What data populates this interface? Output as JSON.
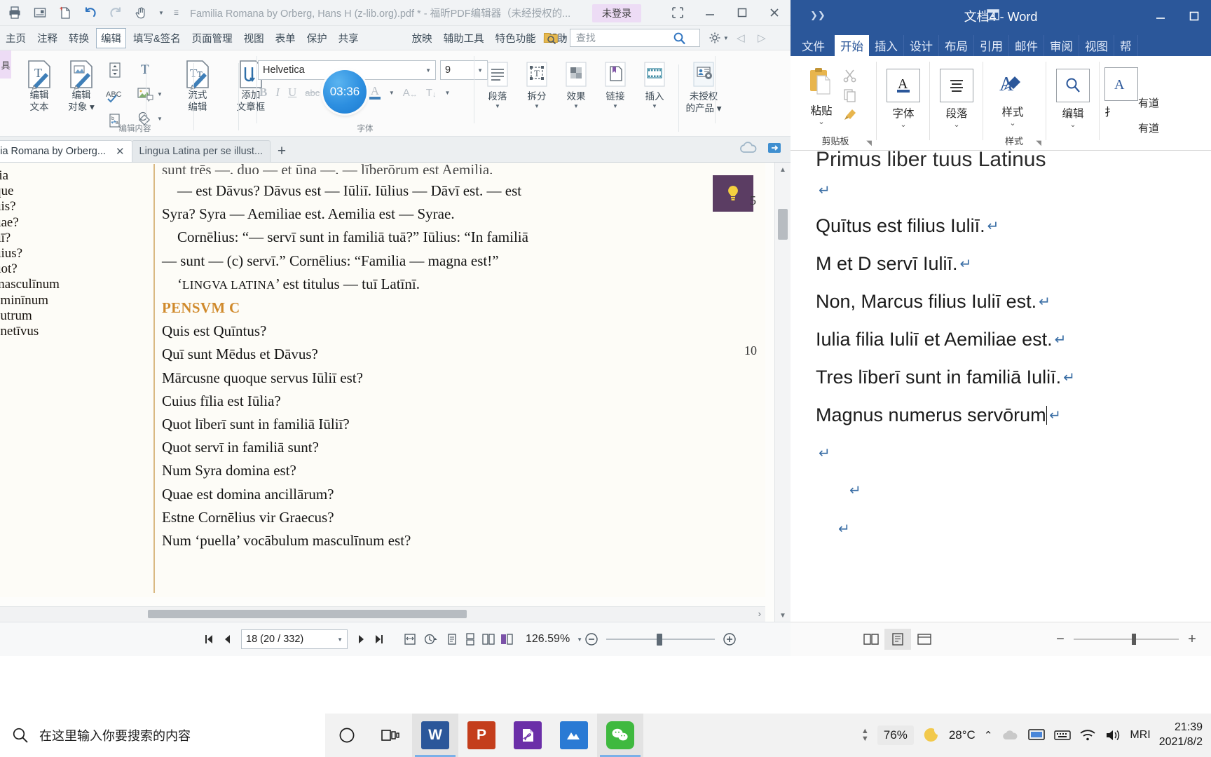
{
  "foxit": {
    "window_title": "Familia Romana by Orberg, Hans H (z-lib.org).pdf * - 福昕PDF编辑器（未经授权的...",
    "login_badge": "未登录",
    "quick_access": [
      "print-icon",
      "new-from-page-icon",
      "new-document-icon",
      "undo-icon",
      "redo-icon",
      "hand-tool-icon",
      "customize-qat-icon"
    ],
    "window_buttons": [
      "restore-layout-icon",
      "minimize-icon",
      "maximize-icon",
      "close-icon"
    ],
    "menus": [
      {
        "label": "主页",
        "active": false
      },
      {
        "label": "注释",
        "active": false
      },
      {
        "label": "转换",
        "active": false
      },
      {
        "label": "编辑",
        "active": true
      },
      {
        "label": "填写&签名",
        "active": false
      },
      {
        "label": "页面管理",
        "active": false
      },
      {
        "label": "视图",
        "active": false
      },
      {
        "label": "表单",
        "active": false
      },
      {
        "label": "保护",
        "active": false
      },
      {
        "label": "共享",
        "active": false
      },
      {
        "label": "放映",
        "active": false
      },
      {
        "label": "辅助工具",
        "active": false
      },
      {
        "label": "特色功能",
        "active": false
      },
      {
        "label": "帮助",
        "active": false
      }
    ],
    "search": {
      "placeholder": "查找",
      "value": ""
    },
    "left_badge": "具",
    "timer_badge": "03:36",
    "ribbon": {
      "groups": [
        {
          "label": "编辑内容",
          "buttons": [
            {
              "label": "编辑\n文本",
              "icon": "edit-text-icon"
            },
            {
              "label": "编辑\n对象 ▾",
              "icon": "edit-object-icon"
            },
            {
              "label": "流式\n编辑",
              "icon": "flow-edit-icon"
            },
            {
              "label": "添加\n文章框",
              "icon": "add-article-box-icon"
            }
          ]
        },
        {
          "label": "字体",
          "buttons": []
        }
      ],
      "font_name": "Helvetica",
      "font_size": "9",
      "format_buttons": [
        "B",
        "I",
        "U",
        "abc",
        "X²",
        "X₂",
        "font-color-icon",
        "text-direction-icon",
        "line-spacing-icon"
      ],
      "tools": [
        {
          "label": "段落",
          "icon": "paragraph-icon"
        },
        {
          "label": "拆分",
          "icon": "split-icon"
        },
        {
          "label": "效果",
          "icon": "effect-icon"
        },
        {
          "label": "链接",
          "icon": "link-icon"
        },
        {
          "label": "插入",
          "icon": "insert-icon"
        },
        {
          "label": "未授权\n的产品 ▾",
          "icon": "unlicensed-product-icon"
        }
      ]
    },
    "tabs": [
      {
        "label": "lia Romana by Orberg...",
        "active": true,
        "closable": true
      },
      {
        "label": "Lingua Latina per se illust...",
        "active": false,
        "closable": false
      }
    ],
    "new_tab_label": "+",
    "document": {
      "margin_notes": [
        "ria",
        "que",
        "uis?",
        "uae?",
        "uī?",
        "uius?",
        "uot?",
        "masculīnum",
        "ēminīnum",
        "eutrum",
        "enetīvus"
      ],
      "clipped_line": "sunt trēs —. duo — et ūna —. — līberōrum est Aemilia.",
      "paragraphs": [
        "— est Dāvus? Dāvus est — Iūliī. Iūlius — Dāvī est. — est",
        "Syra? Syra — Aemiliae est. Aemilia est — Syrae.",
        "Cornēlius: “— servī sunt in familiā tuā?” Iūlius: “In familiā",
        "— sunt — (c) servī.” Cornēlius: “Familia — magna est!”"
      ],
      "lingva_line_pre": "‘",
      "lingva_smallcaps": "LINGVA LATINA",
      "lingva_line_post": "’ est titulus — tuī Latīnī.",
      "pensum_heading": "PENSVM C",
      "questions": [
        "Quis est Quīntus?",
        "Quī sunt Mēdus et Dāvus?",
        "Mārcusne quoque servus Iūliī est?",
        "Cuius fīlia est Iūlia?",
        "Quot līberī sunt in familiā Iūliī?",
        "Quot servī in familiā sunt?",
        "Num Syra domina est?",
        "Quae est domina ancillārum?",
        "Estne Cornēlius vir Graecus?",
        "Num ‘puella’ vocābulum masculīnum est?"
      ],
      "line_numbers": [
        "5",
        "10"
      ]
    },
    "status": {
      "page_value": "18 (20 / 332)",
      "zoom": "126.59%",
      "nav_buttons": [
        "first-page-icon",
        "previous-page-icon",
        "next-page-icon",
        "last-page-icon"
      ],
      "view_buttons": [
        "fit-page-icon",
        "rotate-icon",
        "single-page-icon",
        "continuous-page-icon",
        "two-page-icon",
        "two-page-cover-icon"
      ],
      "zoom_out": "−",
      "zoom_in": "+"
    }
  },
  "word": {
    "window_title": "文档4 - Word",
    "window_buttons": [
      "ribbon-display-options-icon",
      "minimize-icon",
      "maximize-icon"
    ],
    "tabs": [
      {
        "label": "文件",
        "active": false
      },
      {
        "label": "开始",
        "active": true
      },
      {
        "label": "插入",
        "active": false
      },
      {
        "label": "设计",
        "active": false
      },
      {
        "label": "布局",
        "active": false
      },
      {
        "label": "引用",
        "active": false
      },
      {
        "label": "邮件",
        "active": false
      },
      {
        "label": "审阅",
        "active": false
      },
      {
        "label": "视图",
        "active": false
      },
      {
        "label": "帮",
        "active": false
      }
    ],
    "ribbon": {
      "paste_label": "粘贴",
      "clipboard_label": "剪贴板",
      "clipboard_icons": [
        "paste-icon",
        "cut-icon",
        "copy-icon",
        "format-painter-icon"
      ],
      "groups": [
        {
          "label": "字体",
          "icon": "font-icon"
        },
        {
          "label": "段落",
          "icon": "paragraph-icon"
        },
        {
          "label": "样式",
          "icon": "styles-icon"
        },
        {
          "label": "编辑",
          "icon": "editing-icon"
        }
      ],
      "styles_group_label": "样式",
      "partial_label": "扌",
      "style_items": [
        "有道",
        "有道"
      ]
    },
    "document": {
      "heading": "Primus liber tuus Latinus",
      "lines": [
        "Quītus est filius Iuliī.",
        "M et D servī Iuliī.",
        "Non, Marcus filius Iuliī est.",
        "Iulia filia Iuliī et Aemiliae est.",
        "Tres līberī sunt in familiā Iuliī.",
        "Magnus numerus servōrum"
      ],
      "pilcrow": "↵"
    },
    "status": {
      "view_buttons": [
        "read-mode-icon",
        "print-layout-icon",
        "web-layout-icon"
      ],
      "zoom_out": "−",
      "zoom_in": "+"
    }
  },
  "taskbar": {
    "search_placeholder": "在这里输入你要搜索的内容",
    "search_icon": "search-icon",
    "cortana_icon": "cortana-icon",
    "taskview_icon": "task-view-icon",
    "apps": [
      {
        "name": "word",
        "glyph": "W",
        "color": "#2b579a",
        "active": true
      },
      {
        "name": "powerpoint",
        "glyph": "P",
        "color": "#c43e1c",
        "active": false
      },
      {
        "name": "foxit-pdf",
        "glyph": "",
        "color": "#6b2fa8",
        "active": false
      },
      {
        "name": "unknown-blue-app",
        "glyph": "",
        "color": "#2a7ad4",
        "active": false
      },
      {
        "name": "wechat",
        "glyph": "",
        "color": "#3fb93f",
        "active": true
      }
    ],
    "battery_text": "76%",
    "temperature": "28°C",
    "weather_icon": "moon-icon",
    "tray_icons": [
      "chevron-up-icon",
      "cloud-icon",
      "display-icon",
      "keyboard-icon",
      "wifi-icon",
      "volume-icon"
    ],
    "input_method": "MRI",
    "clock_time": "21:39",
    "clock_date": "2021/8/2"
  }
}
